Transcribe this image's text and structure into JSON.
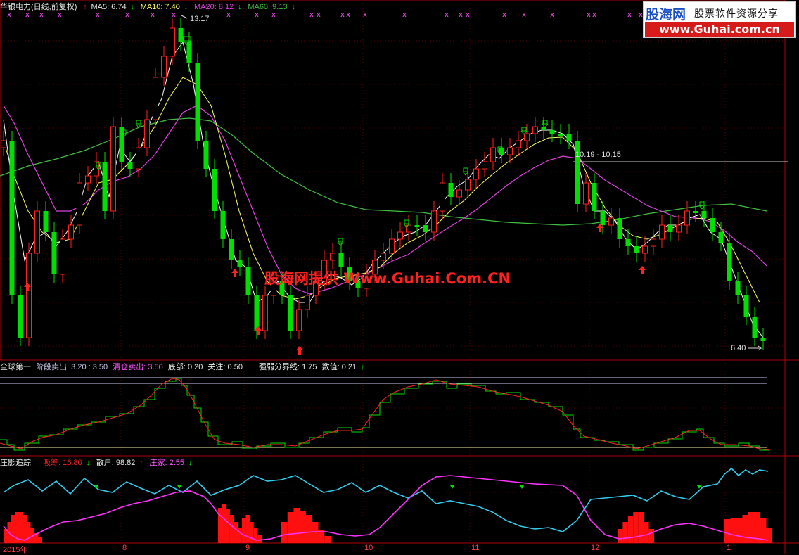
{
  "main_header": {
    "stock_name": "华银电力(日线,前复权)",
    "ma5": "MA5: 6.74",
    "ma10": "MA10: 7.40",
    "ma20": "MA20: 8.12",
    "ma60": "MA60: 9.13"
  },
  "price_labels": {
    "high": "13.17",
    "range": "10.19 - 10.15",
    "low": "6.40"
  },
  "logo": {
    "name": "股海网",
    "tagline": "股票软件资源分享",
    "url": "www.Guhai.com.cn"
  },
  "watermark": "股海网提供 Www.Guhai.Com.CN",
  "indicator1_header": {
    "name": "全球第一",
    "stage_sell": "阶段卖出: 3.20 : 3.50",
    "clear_sell": "清仓卖出: 3.50",
    "bottom": "底部: 0.20",
    "watch": "关注: 0.50",
    "divide": "强弱分界线: 1.75",
    "value": "数值: 0.21"
  },
  "indicator2_header": {
    "name": "庄影追踪",
    "absorb": "吸筹: 16.80",
    "retail": "散户: 98.82",
    "dealer": "庄家: 2.55"
  },
  "time_axis": [
    "2015年",
    "8",
    "9",
    "10",
    "11",
    "12",
    "1"
  ],
  "colors": {
    "up": "#ff2020",
    "down": "#00e000",
    "ma5": "#ffffff",
    "ma10": "#ffff66",
    "ma20": "#e040e0",
    "ma60": "#40c040",
    "retail": "#33ccee",
    "dealer": "#ff33ff"
  }
}
